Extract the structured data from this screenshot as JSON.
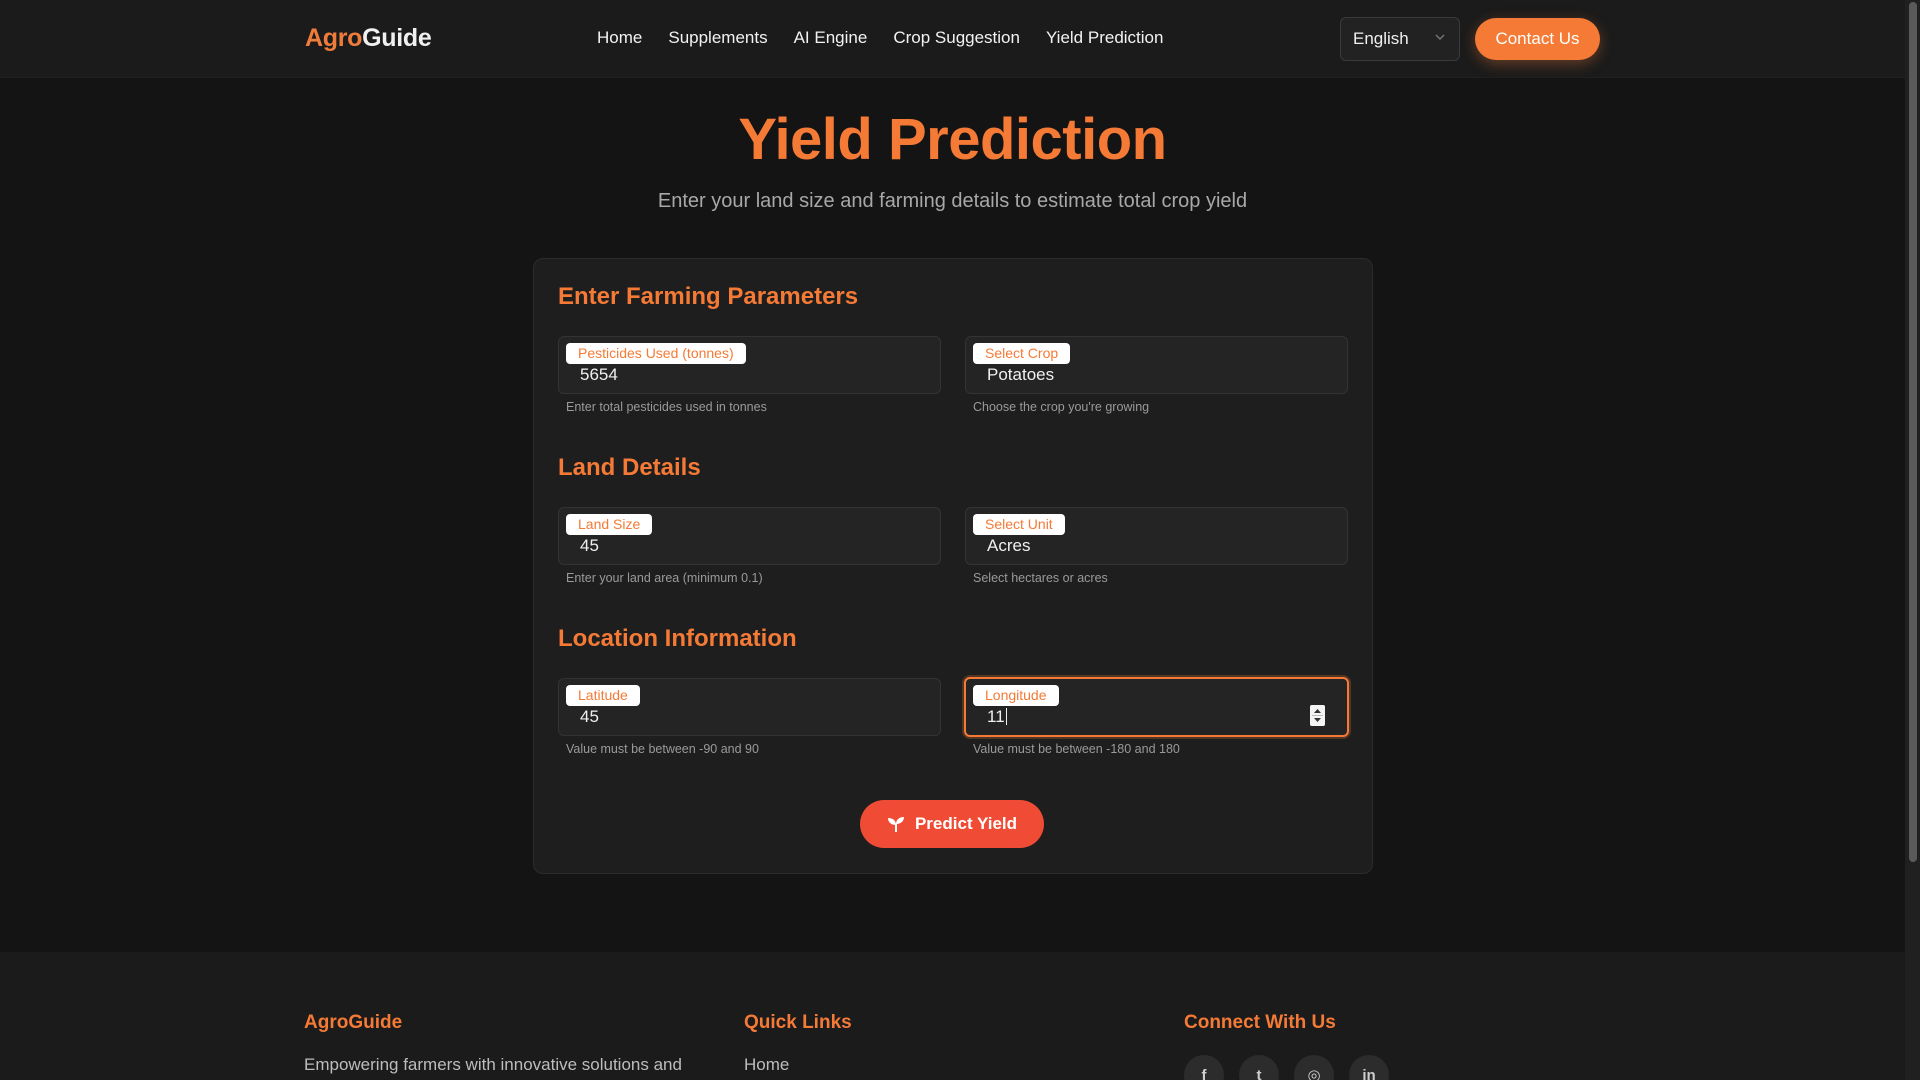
{
  "brand": {
    "part1": "Agro",
    "part2": "Guide"
  },
  "nav": {
    "items": [
      {
        "label": "Home"
      },
      {
        "label": "Supplements"
      },
      {
        "label": "AI Engine"
      },
      {
        "label": "Crop Suggestion"
      },
      {
        "label": "Yield Prediction"
      }
    ]
  },
  "language": {
    "selected": "English"
  },
  "contact_label": "Contact Us",
  "hero": {
    "title": "Yield Prediction",
    "subtitle": "Enter your land size and farming details to estimate total crop yield"
  },
  "form": {
    "sections": {
      "farming": "Enter Farming Parameters",
      "land": "Land Details",
      "location": "Location Information"
    },
    "pesticides": {
      "label": "Pesticides Used (tonnes)",
      "value": "5654",
      "hint": "Enter total pesticides used in tonnes"
    },
    "crop": {
      "label": "Select Crop",
      "value": "Potatoes",
      "hint": "Choose the crop you're growing"
    },
    "land_size": {
      "label": "Land Size",
      "value": "45",
      "hint": "Enter your land area (minimum 0.1)"
    },
    "unit": {
      "label": "Select Unit",
      "value": "Acres",
      "hint": "Select hectares or acres"
    },
    "latitude": {
      "label": "Latitude",
      "value": "45",
      "hint": "Value must be between -90 and 90"
    },
    "longitude": {
      "label": "Longitude",
      "value": "11",
      "hint": "Value must be between -180 and 180"
    },
    "submit_label": "Predict Yield"
  },
  "footer": {
    "brand_title": "AgroGuide",
    "brand_text": "Empowering farmers with innovative solutions and",
    "links_title": "Quick Links",
    "links": [
      "Home"
    ],
    "connect_title": "Connect With Us",
    "social": [
      {
        "icon": "facebook-icon",
        "glyph": "f"
      },
      {
        "icon": "twitter-icon",
        "glyph": "t"
      },
      {
        "icon": "instagram-icon",
        "glyph": "◎"
      },
      {
        "icon": "linkedin-icon",
        "glyph": "in"
      }
    ]
  },
  "colors": {
    "accent": "#f47a36",
    "button_red": "#f04b35",
    "background": "#141414",
    "card": "#1e1e1e"
  }
}
